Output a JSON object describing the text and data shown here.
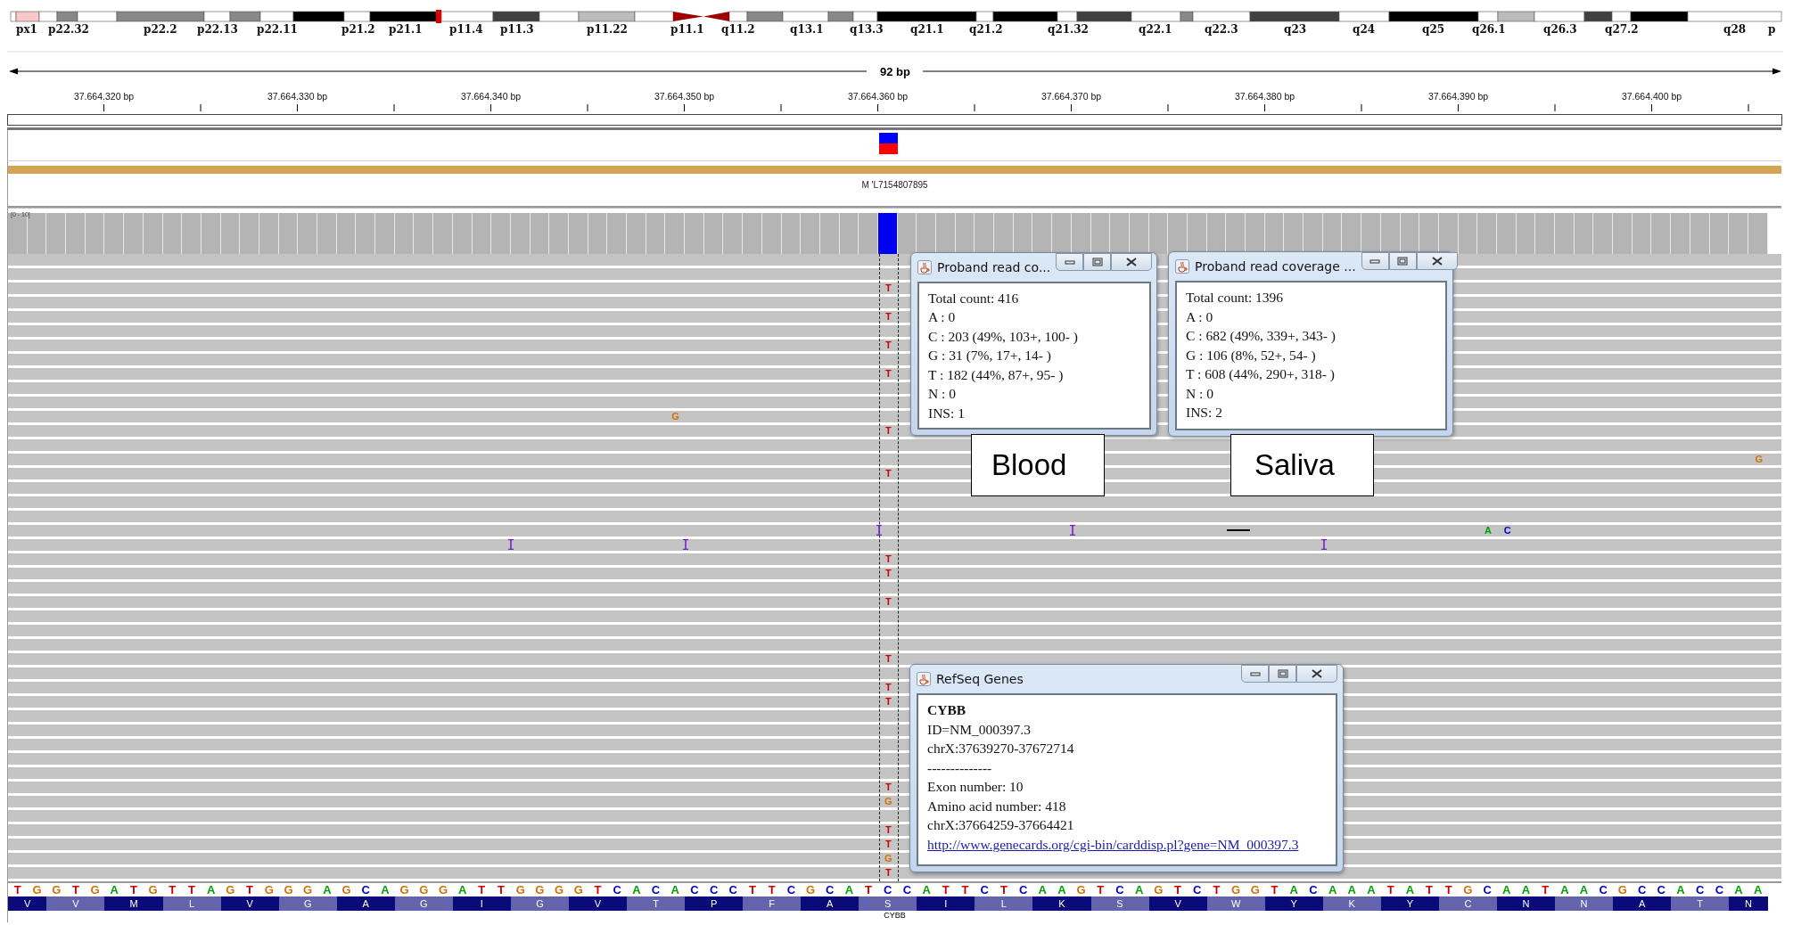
{
  "ideogram": {
    "bands": [
      "px1",
      "p22.32",
      "p22.2",
      "p22.13",
      "p22.11",
      "p21.2",
      "p21.1",
      "p11.4",
      "p11.3",
      "p11.22",
      "p11.1",
      "q11.2",
      "q13.1",
      "q13.3",
      "q21.1",
      "q21.2",
      "q21.32",
      "q22.1",
      "q22.3",
      "q23",
      "q24",
      "q25",
      "q26.1",
      "q26.3",
      "q27.2",
      "q28",
      "p"
    ]
  },
  "ruler": {
    "span": "92 bp",
    "ticks": [
      "37.664.320 bp",
      "37.664.330 bp",
      "37.664.340 bp",
      "37.664.350 bp",
      "37.664.360 bp",
      "37.664.370 bp",
      "37.664.380 bp",
      "37.664.390 bp",
      "37.664.400 bp"
    ]
  },
  "feature_track": {
    "label": "M 'L7154807895"
  },
  "coverage_track": {
    "range": "[0 - 10]"
  },
  "alignments": {
    "marks": [
      {
        "kind": "mismatch",
        "base": "T",
        "color": "#d00000"
      },
      {
        "kind": "mismatch",
        "base": "T",
        "color": "#d00000"
      },
      {
        "kind": "mismatch",
        "base": "T",
        "color": "#d00000"
      },
      {
        "kind": "mismatch",
        "base": "T",
        "color": "#d00000"
      },
      {
        "kind": "mismatch",
        "base": "G",
        "color": "#d17105"
      },
      {
        "kind": "mismatch",
        "base": "T",
        "color": "#d00000"
      },
      {
        "kind": "mismatch",
        "base": "G",
        "color": "#d17105"
      },
      {
        "kind": "mismatch",
        "base": "T",
        "color": "#d00000"
      },
      {
        "kind": "insertion"
      },
      {
        "kind": "insertion"
      },
      {
        "kind": "deletion"
      },
      {
        "kind": "mismatch",
        "base": "A",
        "color": "#00a000"
      },
      {
        "kind": "mismatch",
        "base": "C",
        "color": "#0000c8"
      },
      {
        "kind": "insertion"
      },
      {
        "kind": "insertion"
      },
      {
        "kind": "insertion"
      },
      {
        "kind": "mismatch",
        "base": "T",
        "color": "#d00000"
      },
      {
        "kind": "mismatch",
        "base": "T",
        "color": "#d00000"
      },
      {
        "kind": "mismatch",
        "base": "T",
        "color": "#d00000"
      },
      {
        "kind": "mismatch",
        "base": "T",
        "color": "#d00000"
      },
      {
        "kind": "mismatch",
        "base": "T",
        "color": "#d00000"
      },
      {
        "kind": "mismatch",
        "base": "T",
        "color": "#d00000"
      },
      {
        "kind": "mismatch",
        "base": "T",
        "color": "#d00000"
      },
      {
        "kind": "mismatch",
        "base": "G",
        "color": "#d17105"
      },
      {
        "kind": "mismatch",
        "base": "T",
        "color": "#d00000"
      },
      {
        "kind": "mismatch",
        "base": "T",
        "color": "#d00000"
      },
      {
        "kind": "mismatch",
        "base": "G",
        "color": "#d17105"
      },
      {
        "kind": "mismatch",
        "base": "T",
        "color": "#d00000"
      }
    ]
  },
  "popups": [
    {
      "title": "Proband read co...",
      "lines": [
        "Total count: 416",
        "A : 0",
        "C : 203 (49%, 103+, 100- )",
        "G : 31 (7%, 17+, 14- )",
        "T : 182 (44%, 87+, 95- )",
        "N : 0",
        "INS: 1"
      ]
    },
    {
      "title": "Proband read coverage ...",
      "lines": [
        "Total count: 1396",
        "A : 0",
        "C : 682 (49%, 339+, 343- )",
        "G : 106 (8%, 52+, 54- )",
        "T : 608 (44%, 290+, 318- )",
        "N : 0",
        "INS: 2"
      ]
    }
  ],
  "annotations": [
    "Blood",
    "Saliva"
  ],
  "gene_popup": {
    "title": "RefSeq Genes",
    "gene": "CYBB",
    "lines": [
      "ID=NM_000397.3",
      "chrX:37639270-37672714",
      "--------------",
      "Exon number: 10",
      "Amino acid number: 418",
      "chrX:37664259-37664421"
    ],
    "link": "http://www.genecards.org/cgi-bin/carddisp.pl?gene=NM_000397.3"
  },
  "sequence": [
    {
      "base": "T",
      "color": "#d00000"
    },
    {
      "base": "G",
      "color": "#d17105"
    },
    {
      "base": "G",
      "color": "#d17105"
    },
    {
      "base": "T",
      "color": "#d00000"
    },
    {
      "base": "G",
      "color": "#d17105"
    },
    {
      "base": "A",
      "color": "#00a000"
    },
    {
      "base": "T",
      "color": "#d00000"
    },
    {
      "base": "G",
      "color": "#d17105"
    },
    {
      "base": "T",
      "color": "#d00000"
    },
    {
      "base": "T",
      "color": "#d00000"
    },
    {
      "base": "A",
      "color": "#00a000"
    },
    {
      "base": "G",
      "color": "#d17105"
    },
    {
      "base": "T",
      "color": "#d00000"
    },
    {
      "base": "G",
      "color": "#d17105"
    },
    {
      "base": "G",
      "color": "#d17105"
    },
    {
      "base": "G",
      "color": "#d17105"
    },
    {
      "base": "A",
      "color": "#00a000"
    },
    {
      "base": "G",
      "color": "#d17105"
    },
    {
      "base": "C",
      "color": "#0000c8"
    },
    {
      "base": "A",
      "color": "#00a000"
    },
    {
      "base": "G",
      "color": "#d17105"
    },
    {
      "base": "G",
      "color": "#d17105"
    },
    {
      "base": "G",
      "color": "#d17105"
    },
    {
      "base": "A",
      "color": "#00a000"
    },
    {
      "base": "T",
      "color": "#d00000"
    },
    {
      "base": "T",
      "color": "#d00000"
    },
    {
      "base": "G",
      "color": "#d17105"
    },
    {
      "base": "G",
      "color": "#d17105"
    },
    {
      "base": "G",
      "color": "#d17105"
    },
    {
      "base": "G",
      "color": "#d17105"
    },
    {
      "base": "T",
      "color": "#d00000"
    },
    {
      "base": "C",
      "color": "#0000c8"
    },
    {
      "base": "A",
      "color": "#00a000"
    },
    {
      "base": "C",
      "color": "#0000c8"
    },
    {
      "base": "A",
      "color": "#00a000"
    },
    {
      "base": "C",
      "color": "#0000c8"
    },
    {
      "base": "C",
      "color": "#0000c8"
    },
    {
      "base": "C",
      "color": "#0000c8"
    },
    {
      "base": "T",
      "color": "#d00000"
    },
    {
      "base": "T",
      "color": "#d00000"
    },
    {
      "base": "C",
      "color": "#0000c8"
    },
    {
      "base": "G",
      "color": "#d17105"
    },
    {
      "base": "C",
      "color": "#0000c8"
    },
    {
      "base": "A",
      "color": "#00a000"
    },
    {
      "base": "T",
      "color": "#d00000"
    },
    {
      "base": "C",
      "color": "#0000c8"
    },
    {
      "base": "C",
      "color": "#0000c8"
    },
    {
      "base": "A",
      "color": "#00a000"
    },
    {
      "base": "T",
      "color": "#d00000"
    },
    {
      "base": "T",
      "color": "#d00000"
    },
    {
      "base": "C",
      "color": "#0000c8"
    },
    {
      "base": "T",
      "color": "#d00000"
    },
    {
      "base": "C",
      "color": "#0000c8"
    },
    {
      "base": "A",
      "color": "#00a000"
    },
    {
      "base": "A",
      "color": "#00a000"
    },
    {
      "base": "G",
      "color": "#d17105"
    },
    {
      "base": "T",
      "color": "#d00000"
    },
    {
      "base": "C",
      "color": "#0000c8"
    },
    {
      "base": "A",
      "color": "#00a000"
    },
    {
      "base": "G",
      "color": "#d17105"
    },
    {
      "base": "T",
      "color": "#d00000"
    },
    {
      "base": "C",
      "color": "#0000c8"
    },
    {
      "base": "T",
      "color": "#d00000"
    },
    {
      "base": "G",
      "color": "#d17105"
    },
    {
      "base": "G",
      "color": "#d17105"
    },
    {
      "base": "T",
      "color": "#d00000"
    },
    {
      "base": "A",
      "color": "#00a000"
    },
    {
      "base": "C",
      "color": "#0000c8"
    },
    {
      "base": "A",
      "color": "#00a000"
    },
    {
      "base": "A",
      "color": "#00a000"
    },
    {
      "base": "A",
      "color": "#00a000"
    },
    {
      "base": "T",
      "color": "#d00000"
    },
    {
      "base": "A",
      "color": "#00a000"
    },
    {
      "base": "T",
      "color": "#d00000"
    },
    {
      "base": "T",
      "color": "#d00000"
    },
    {
      "base": "G",
      "color": "#d17105"
    },
    {
      "base": "C",
      "color": "#0000c8"
    },
    {
      "base": "A",
      "color": "#00a000"
    },
    {
      "base": "A",
      "color": "#00a000"
    },
    {
      "base": "T",
      "color": "#d00000"
    },
    {
      "base": "A",
      "color": "#00a000"
    },
    {
      "base": "A",
      "color": "#00a000"
    },
    {
      "base": "C",
      "color": "#0000c8"
    },
    {
      "base": "G",
      "color": "#d17105"
    },
    {
      "base": "C",
      "color": "#0000c8"
    },
    {
      "base": "C",
      "color": "#0000c8"
    },
    {
      "base": "A",
      "color": "#00a000"
    },
    {
      "base": "C",
      "color": "#0000c8"
    },
    {
      "base": "C",
      "color": "#0000c8"
    },
    {
      "base": "A",
      "color": "#00a000"
    },
    {
      "base": "A",
      "color": "#00a000"
    }
  ],
  "translation": {
    "amino_acids": [
      "V",
      "V",
      "M",
      "L",
      "V",
      "G",
      "A",
      "G",
      "I",
      "G",
      "V",
      "T",
      "P",
      "F",
      "A",
      "S",
      "I",
      "L",
      "K",
      "S",
      "V",
      "W",
      "Y",
      "K",
      "Y",
      "C",
      "N",
      "N",
      "A",
      "T",
      "N"
    ],
    "gene": "CYBB"
  }
}
